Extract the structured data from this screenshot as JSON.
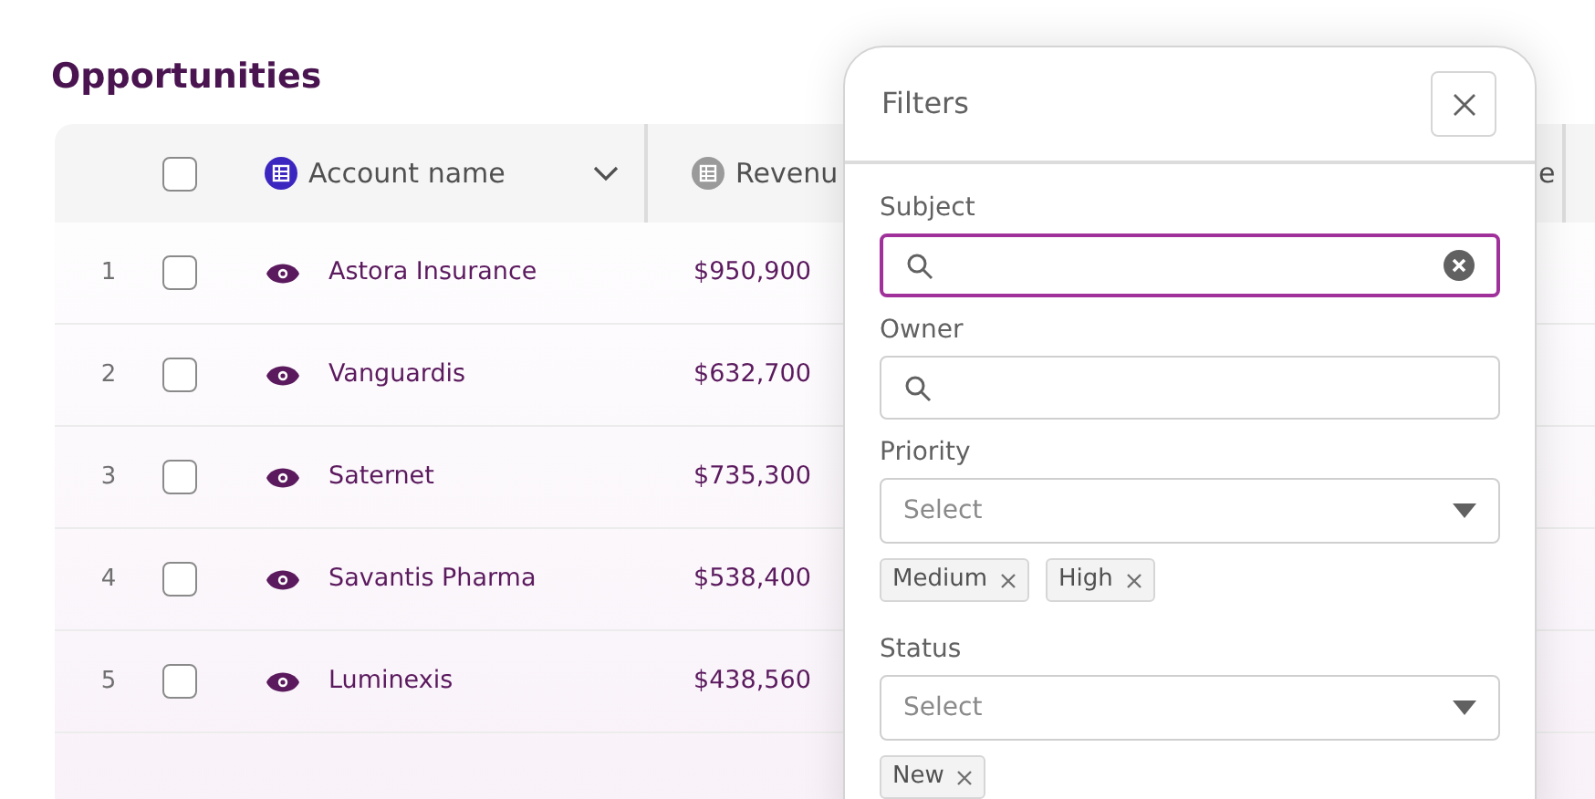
{
  "page": {
    "title": "Opportunities"
  },
  "table": {
    "columns": [
      {
        "label": "Account name",
        "kind": "primary"
      },
      {
        "label": "Revenu",
        "kind": "plain"
      },
      {
        "label": "e",
        "kind": "cut"
      }
    ],
    "header_checkbox": {
      "checked": false
    },
    "rows": [
      {
        "number": "1",
        "checked": false,
        "account": "Astora Insurance",
        "revenue": "$950,900"
      },
      {
        "number": "2",
        "checked": false,
        "account": "Vanguardis",
        "revenue": "$632,700"
      },
      {
        "number": "3",
        "checked": false,
        "account": "Saternet",
        "revenue": "$735,300"
      },
      {
        "number": "4",
        "checked": false,
        "account": "Savantis Pharma",
        "revenue": "$538,400"
      },
      {
        "number": "5",
        "checked": false,
        "account": "Luminexis",
        "revenue": "$438,560"
      }
    ]
  },
  "filters": {
    "title": "Filters",
    "fields": [
      {
        "label": "Subject",
        "kind": "search",
        "focused": true,
        "clearable": true
      },
      {
        "label": "Owner",
        "kind": "search",
        "focused": false,
        "clearable": false
      },
      {
        "label": "Priority",
        "kind": "select",
        "placeholder": "Select",
        "tags": [
          "Medium",
          "High"
        ]
      },
      {
        "label": "Status",
        "kind": "select",
        "placeholder": "Select",
        "tags": [
          "New"
        ]
      }
    ]
  }
}
